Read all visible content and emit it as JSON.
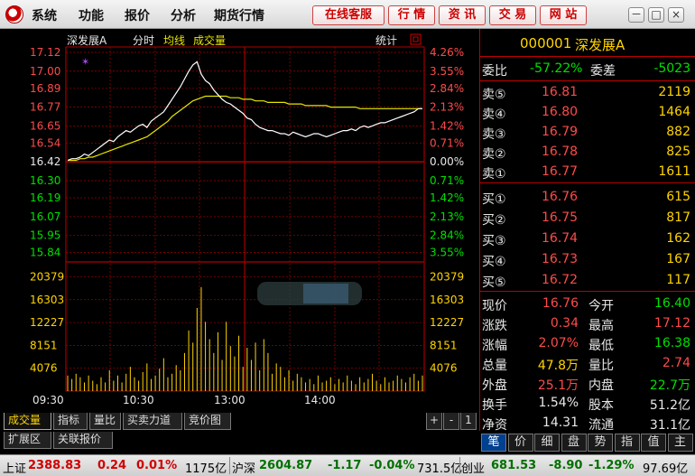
{
  "menubar": {
    "items": [
      "系统",
      "功能",
      "报价",
      "分析",
      "期货行情"
    ],
    "buttons": [
      "在线客服",
      "行 情",
      "资 讯",
      "交 易",
      "网 站"
    ],
    "window_controls": [
      "－",
      "□",
      "×"
    ]
  },
  "chart_header": {
    "stock_name": "深发展A",
    "mode": "分时",
    "avg_label": "均线",
    "volume_label": "成交量",
    "stats_label": "统计"
  },
  "chart_data": {
    "type": "line",
    "price_ticks": [
      "17.12",
      "17.00",
      "16.89",
      "16.77",
      "16.65",
      "16.54",
      "16.42",
      "16.30",
      "16.19",
      "16.07",
      "15.95",
      "15.84"
    ],
    "price_values": [
      17.12,
      17.0,
      16.89,
      16.77,
      16.65,
      16.54,
      16.42,
      16.3,
      16.19,
      16.07,
      15.95,
      15.84
    ],
    "pct_ticks": [
      "4.26%",
      "3.55%",
      "2.84%",
      "2.13%",
      "1.42%",
      "0.71%",
      "0.00%",
      "0.71%",
      "1.42%",
      "2.13%",
      "2.84%",
      "3.55%"
    ],
    "vol_ticks": [
      "20379",
      "16303",
      "12227",
      "8151",
      "4076"
    ],
    "vol_values": [
      20379,
      16303,
      12227,
      8151,
      4076
    ],
    "time_ticks": [
      "09:30",
      "10:30",
      "13:00",
      "14:00"
    ],
    "prev_close": 16.42,
    "ylim": [
      15.78,
      17.12
    ],
    "series": [
      {
        "name": "price",
        "color": "#ffffff",
        "values": [
          16.43,
          16.44,
          16.44,
          16.45,
          16.47,
          16.46,
          16.48,
          16.5,
          16.52,
          16.54,
          16.56,
          16.55,
          16.58,
          16.6,
          16.62,
          16.61,
          16.63,
          16.65,
          16.66,
          16.64,
          16.68,
          16.7,
          16.72,
          16.74,
          16.78,
          16.82,
          16.86,
          16.9,
          16.95,
          17.0,
          17.04,
          17.06,
          16.98,
          16.94,
          16.92,
          16.88,
          16.85,
          16.82,
          16.8,
          16.79,
          16.77,
          16.75,
          16.73,
          16.7,
          16.69,
          16.66,
          16.64,
          16.63,
          16.62,
          16.62,
          16.61,
          16.6,
          16.6,
          16.59,
          16.61,
          16.6,
          16.59,
          16.58,
          16.59,
          16.6,
          16.6,
          16.59,
          16.58,
          16.59,
          16.6,
          16.61,
          16.62,
          16.62,
          16.63,
          16.62,
          16.64,
          16.65,
          16.64,
          16.65,
          16.66,
          16.67,
          16.67,
          16.68,
          16.69,
          16.7,
          16.71,
          16.72,
          16.73,
          16.74,
          16.76,
          16.76
        ]
      },
      {
        "name": "average",
        "color": "#e6e600",
        "values": [
          16.43,
          16.43,
          16.43,
          16.44,
          16.44,
          16.45,
          16.45,
          16.46,
          16.47,
          16.48,
          16.49,
          16.5,
          16.51,
          16.52,
          16.53,
          16.54,
          16.55,
          16.56,
          16.57,
          16.58,
          16.6,
          16.62,
          16.64,
          16.66,
          16.68,
          16.71,
          16.73,
          16.75,
          16.77,
          16.79,
          16.81,
          16.82,
          16.83,
          16.84,
          16.84,
          16.84,
          16.84,
          16.84,
          16.84,
          16.83,
          16.83,
          16.83,
          16.82,
          16.82,
          16.82,
          16.81,
          16.81,
          16.81,
          16.8,
          16.8,
          16.8,
          16.8,
          16.8,
          16.79,
          16.79,
          16.79,
          16.79,
          16.78,
          16.78,
          16.78,
          16.78,
          16.78,
          16.78,
          16.77,
          16.77,
          16.77,
          16.77,
          16.77,
          16.77,
          16.77,
          16.76,
          16.76,
          16.76,
          16.76,
          16.76,
          16.76,
          16.76,
          16.76,
          16.76,
          16.76,
          16.76,
          16.76,
          16.76,
          16.76,
          16.76,
          16.76
        ]
      }
    ],
    "volume": [
      9,
      7,
      10,
      8,
      5,
      9,
      6,
      4,
      8,
      5,
      12,
      6,
      9,
      5,
      10,
      14,
      8,
      6,
      11,
      16,
      7,
      9,
      13,
      19,
      8,
      10,
      15,
      12,
      22,
      35,
      28,
      48,
      60,
      40,
      30,
      22,
      34,
      18,
      40,
      26,
      20,
      32,
      14,
      25,
      18,
      28,
      12,
      30,
      22,
      10,
      16,
      14,
      8,
      12,
      6,
      10,
      8,
      5,
      7,
      4,
      9,
      5,
      6,
      8,
      4,
      7,
      5,
      9,
      6,
      4,
      8,
      5,
      7,
      10,
      6,
      4,
      8,
      5,
      6,
      9,
      7,
      5,
      8,
      10,
      6,
      9
    ]
  },
  "quote": {
    "code": "000001",
    "name": "深发展A",
    "weibi_label": "委比",
    "weibi": "-57.22%",
    "weicha_label": "委差",
    "weicha": "-5023",
    "asks": [
      {
        "label": "卖⑤",
        "price": "16.81",
        "vol": "2119"
      },
      {
        "label": "卖④",
        "price": "16.80",
        "vol": "1464"
      },
      {
        "label": "卖③",
        "price": "16.79",
        "vol": "882"
      },
      {
        "label": "卖②",
        "price": "16.78",
        "vol": "825"
      },
      {
        "label": "卖①",
        "price": "16.77",
        "vol": "1611"
      }
    ],
    "bids": [
      {
        "label": "买①",
        "price": "16.76",
        "vol": "615"
      },
      {
        "label": "买②",
        "price": "16.75",
        "vol": "817"
      },
      {
        "label": "买③",
        "price": "16.74",
        "vol": "162"
      },
      {
        "label": "买④",
        "price": "16.73",
        "vol": "167"
      },
      {
        "label": "买⑤",
        "price": "16.72",
        "vol": "117"
      }
    ],
    "stats": [
      {
        "l1": "现价",
        "v1": "16.76",
        "c1": "red",
        "l2": "今开",
        "v2": "16.40",
        "c2": "green"
      },
      {
        "l1": "涨跌",
        "v1": "0.34",
        "c1": "red",
        "l2": "最高",
        "v2": "17.12",
        "c2": "red"
      },
      {
        "l1": "涨幅",
        "v1": "2.07%",
        "c1": "red",
        "l2": "最低",
        "v2": "16.38",
        "c2": "green"
      },
      {
        "l1": "总量",
        "v1": "47.8万",
        "c1": "yellow",
        "l2": "量比",
        "v2": "2.74",
        "c2": "red"
      },
      {
        "l1": "外盘",
        "v1": "25.1万",
        "c1": "red",
        "l2": "内盘",
        "v2": "22.7万",
        "c2": "green"
      },
      {
        "l1": "换手",
        "v1": "1.54%",
        "c1": "white",
        "l2": "股本",
        "v2": "51.2亿",
        "c2": "white"
      },
      {
        "l1": "净资",
        "v1": "14.31",
        "c1": "white",
        "l2": "流通",
        "v2": "31.1亿",
        "c2": "white"
      }
    ]
  },
  "bottom_tabs": {
    "row1": [
      "成交量",
      "指标",
      "量比",
      "买卖力道",
      "竞价图"
    ],
    "row2": [
      "扩展区",
      "关联报价"
    ],
    "controls": [
      "+",
      "-",
      "1"
    ],
    "right": [
      "笔",
      "价",
      "细",
      "盘",
      "势",
      "指",
      "值",
      "主"
    ]
  },
  "status": {
    "sh_label": "上证",
    "sh_val": "2388.83",
    "sh_chg": "0.24",
    "sh_pct": "0.01%",
    "sh_amt": "1175亿",
    "hs_label": "沪深",
    "hs_val": "2604.87",
    "hs_chg": "-1.17",
    "hs_pct": "-0.04%",
    "hs_amt": "731.5亿",
    "cy_label": "创业",
    "cy_val": "681.53",
    "cy_chg": "-8.90",
    "cy_pct": "-1.29%",
    "cy_amt": "97.69亿"
  }
}
